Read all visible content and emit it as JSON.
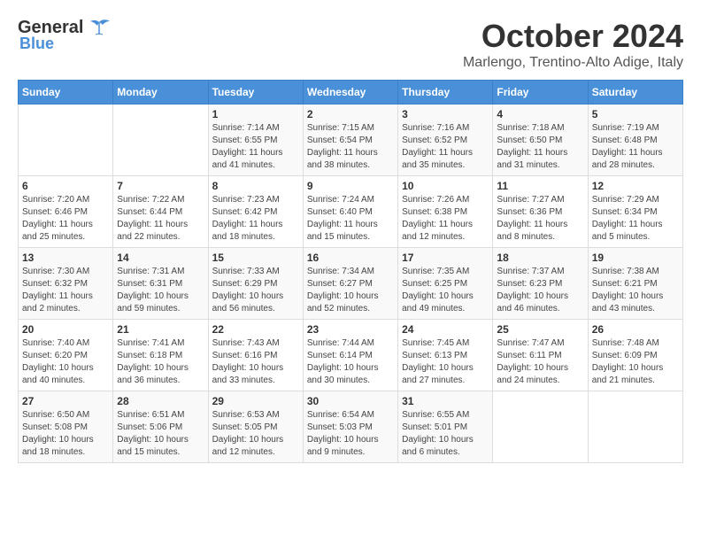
{
  "header": {
    "logo_general": "General",
    "logo_blue": "Blue",
    "month_title": "October 2024",
    "location": "Marlengo, Trentino-Alto Adige, Italy"
  },
  "days_of_week": [
    "Sunday",
    "Monday",
    "Tuesday",
    "Wednesday",
    "Thursday",
    "Friday",
    "Saturday"
  ],
  "weeks": [
    [
      {
        "day": "",
        "detail": ""
      },
      {
        "day": "",
        "detail": ""
      },
      {
        "day": "1",
        "detail": "Sunrise: 7:14 AM\nSunset: 6:55 PM\nDaylight: 11 hours and 41 minutes."
      },
      {
        "day": "2",
        "detail": "Sunrise: 7:15 AM\nSunset: 6:54 PM\nDaylight: 11 hours and 38 minutes."
      },
      {
        "day": "3",
        "detail": "Sunrise: 7:16 AM\nSunset: 6:52 PM\nDaylight: 11 hours and 35 minutes."
      },
      {
        "day": "4",
        "detail": "Sunrise: 7:18 AM\nSunset: 6:50 PM\nDaylight: 11 hours and 31 minutes."
      },
      {
        "day": "5",
        "detail": "Sunrise: 7:19 AM\nSunset: 6:48 PM\nDaylight: 11 hours and 28 minutes."
      }
    ],
    [
      {
        "day": "6",
        "detail": "Sunrise: 7:20 AM\nSunset: 6:46 PM\nDaylight: 11 hours and 25 minutes."
      },
      {
        "day": "7",
        "detail": "Sunrise: 7:22 AM\nSunset: 6:44 PM\nDaylight: 11 hours and 22 minutes."
      },
      {
        "day": "8",
        "detail": "Sunrise: 7:23 AM\nSunset: 6:42 PM\nDaylight: 11 hours and 18 minutes."
      },
      {
        "day": "9",
        "detail": "Sunrise: 7:24 AM\nSunset: 6:40 PM\nDaylight: 11 hours and 15 minutes."
      },
      {
        "day": "10",
        "detail": "Sunrise: 7:26 AM\nSunset: 6:38 PM\nDaylight: 11 hours and 12 minutes."
      },
      {
        "day": "11",
        "detail": "Sunrise: 7:27 AM\nSunset: 6:36 PM\nDaylight: 11 hours and 8 minutes."
      },
      {
        "day": "12",
        "detail": "Sunrise: 7:29 AM\nSunset: 6:34 PM\nDaylight: 11 hours and 5 minutes."
      }
    ],
    [
      {
        "day": "13",
        "detail": "Sunrise: 7:30 AM\nSunset: 6:32 PM\nDaylight: 11 hours and 2 minutes."
      },
      {
        "day": "14",
        "detail": "Sunrise: 7:31 AM\nSunset: 6:31 PM\nDaylight: 10 hours and 59 minutes."
      },
      {
        "day": "15",
        "detail": "Sunrise: 7:33 AM\nSunset: 6:29 PM\nDaylight: 10 hours and 56 minutes."
      },
      {
        "day": "16",
        "detail": "Sunrise: 7:34 AM\nSunset: 6:27 PM\nDaylight: 10 hours and 52 minutes."
      },
      {
        "day": "17",
        "detail": "Sunrise: 7:35 AM\nSunset: 6:25 PM\nDaylight: 10 hours and 49 minutes."
      },
      {
        "day": "18",
        "detail": "Sunrise: 7:37 AM\nSunset: 6:23 PM\nDaylight: 10 hours and 46 minutes."
      },
      {
        "day": "19",
        "detail": "Sunrise: 7:38 AM\nSunset: 6:21 PM\nDaylight: 10 hours and 43 minutes."
      }
    ],
    [
      {
        "day": "20",
        "detail": "Sunrise: 7:40 AM\nSunset: 6:20 PM\nDaylight: 10 hours and 40 minutes."
      },
      {
        "day": "21",
        "detail": "Sunrise: 7:41 AM\nSunset: 6:18 PM\nDaylight: 10 hours and 36 minutes."
      },
      {
        "day": "22",
        "detail": "Sunrise: 7:43 AM\nSunset: 6:16 PM\nDaylight: 10 hours and 33 minutes."
      },
      {
        "day": "23",
        "detail": "Sunrise: 7:44 AM\nSunset: 6:14 PM\nDaylight: 10 hours and 30 minutes."
      },
      {
        "day": "24",
        "detail": "Sunrise: 7:45 AM\nSunset: 6:13 PM\nDaylight: 10 hours and 27 minutes."
      },
      {
        "day": "25",
        "detail": "Sunrise: 7:47 AM\nSunset: 6:11 PM\nDaylight: 10 hours and 24 minutes."
      },
      {
        "day": "26",
        "detail": "Sunrise: 7:48 AM\nSunset: 6:09 PM\nDaylight: 10 hours and 21 minutes."
      }
    ],
    [
      {
        "day": "27",
        "detail": "Sunrise: 6:50 AM\nSunset: 5:08 PM\nDaylight: 10 hours and 18 minutes."
      },
      {
        "day": "28",
        "detail": "Sunrise: 6:51 AM\nSunset: 5:06 PM\nDaylight: 10 hours and 15 minutes."
      },
      {
        "day": "29",
        "detail": "Sunrise: 6:53 AM\nSunset: 5:05 PM\nDaylight: 10 hours and 12 minutes."
      },
      {
        "day": "30",
        "detail": "Sunrise: 6:54 AM\nSunset: 5:03 PM\nDaylight: 10 hours and 9 minutes."
      },
      {
        "day": "31",
        "detail": "Sunrise: 6:55 AM\nSunset: 5:01 PM\nDaylight: 10 hours and 6 minutes."
      },
      {
        "day": "",
        "detail": ""
      },
      {
        "day": "",
        "detail": ""
      }
    ]
  ]
}
